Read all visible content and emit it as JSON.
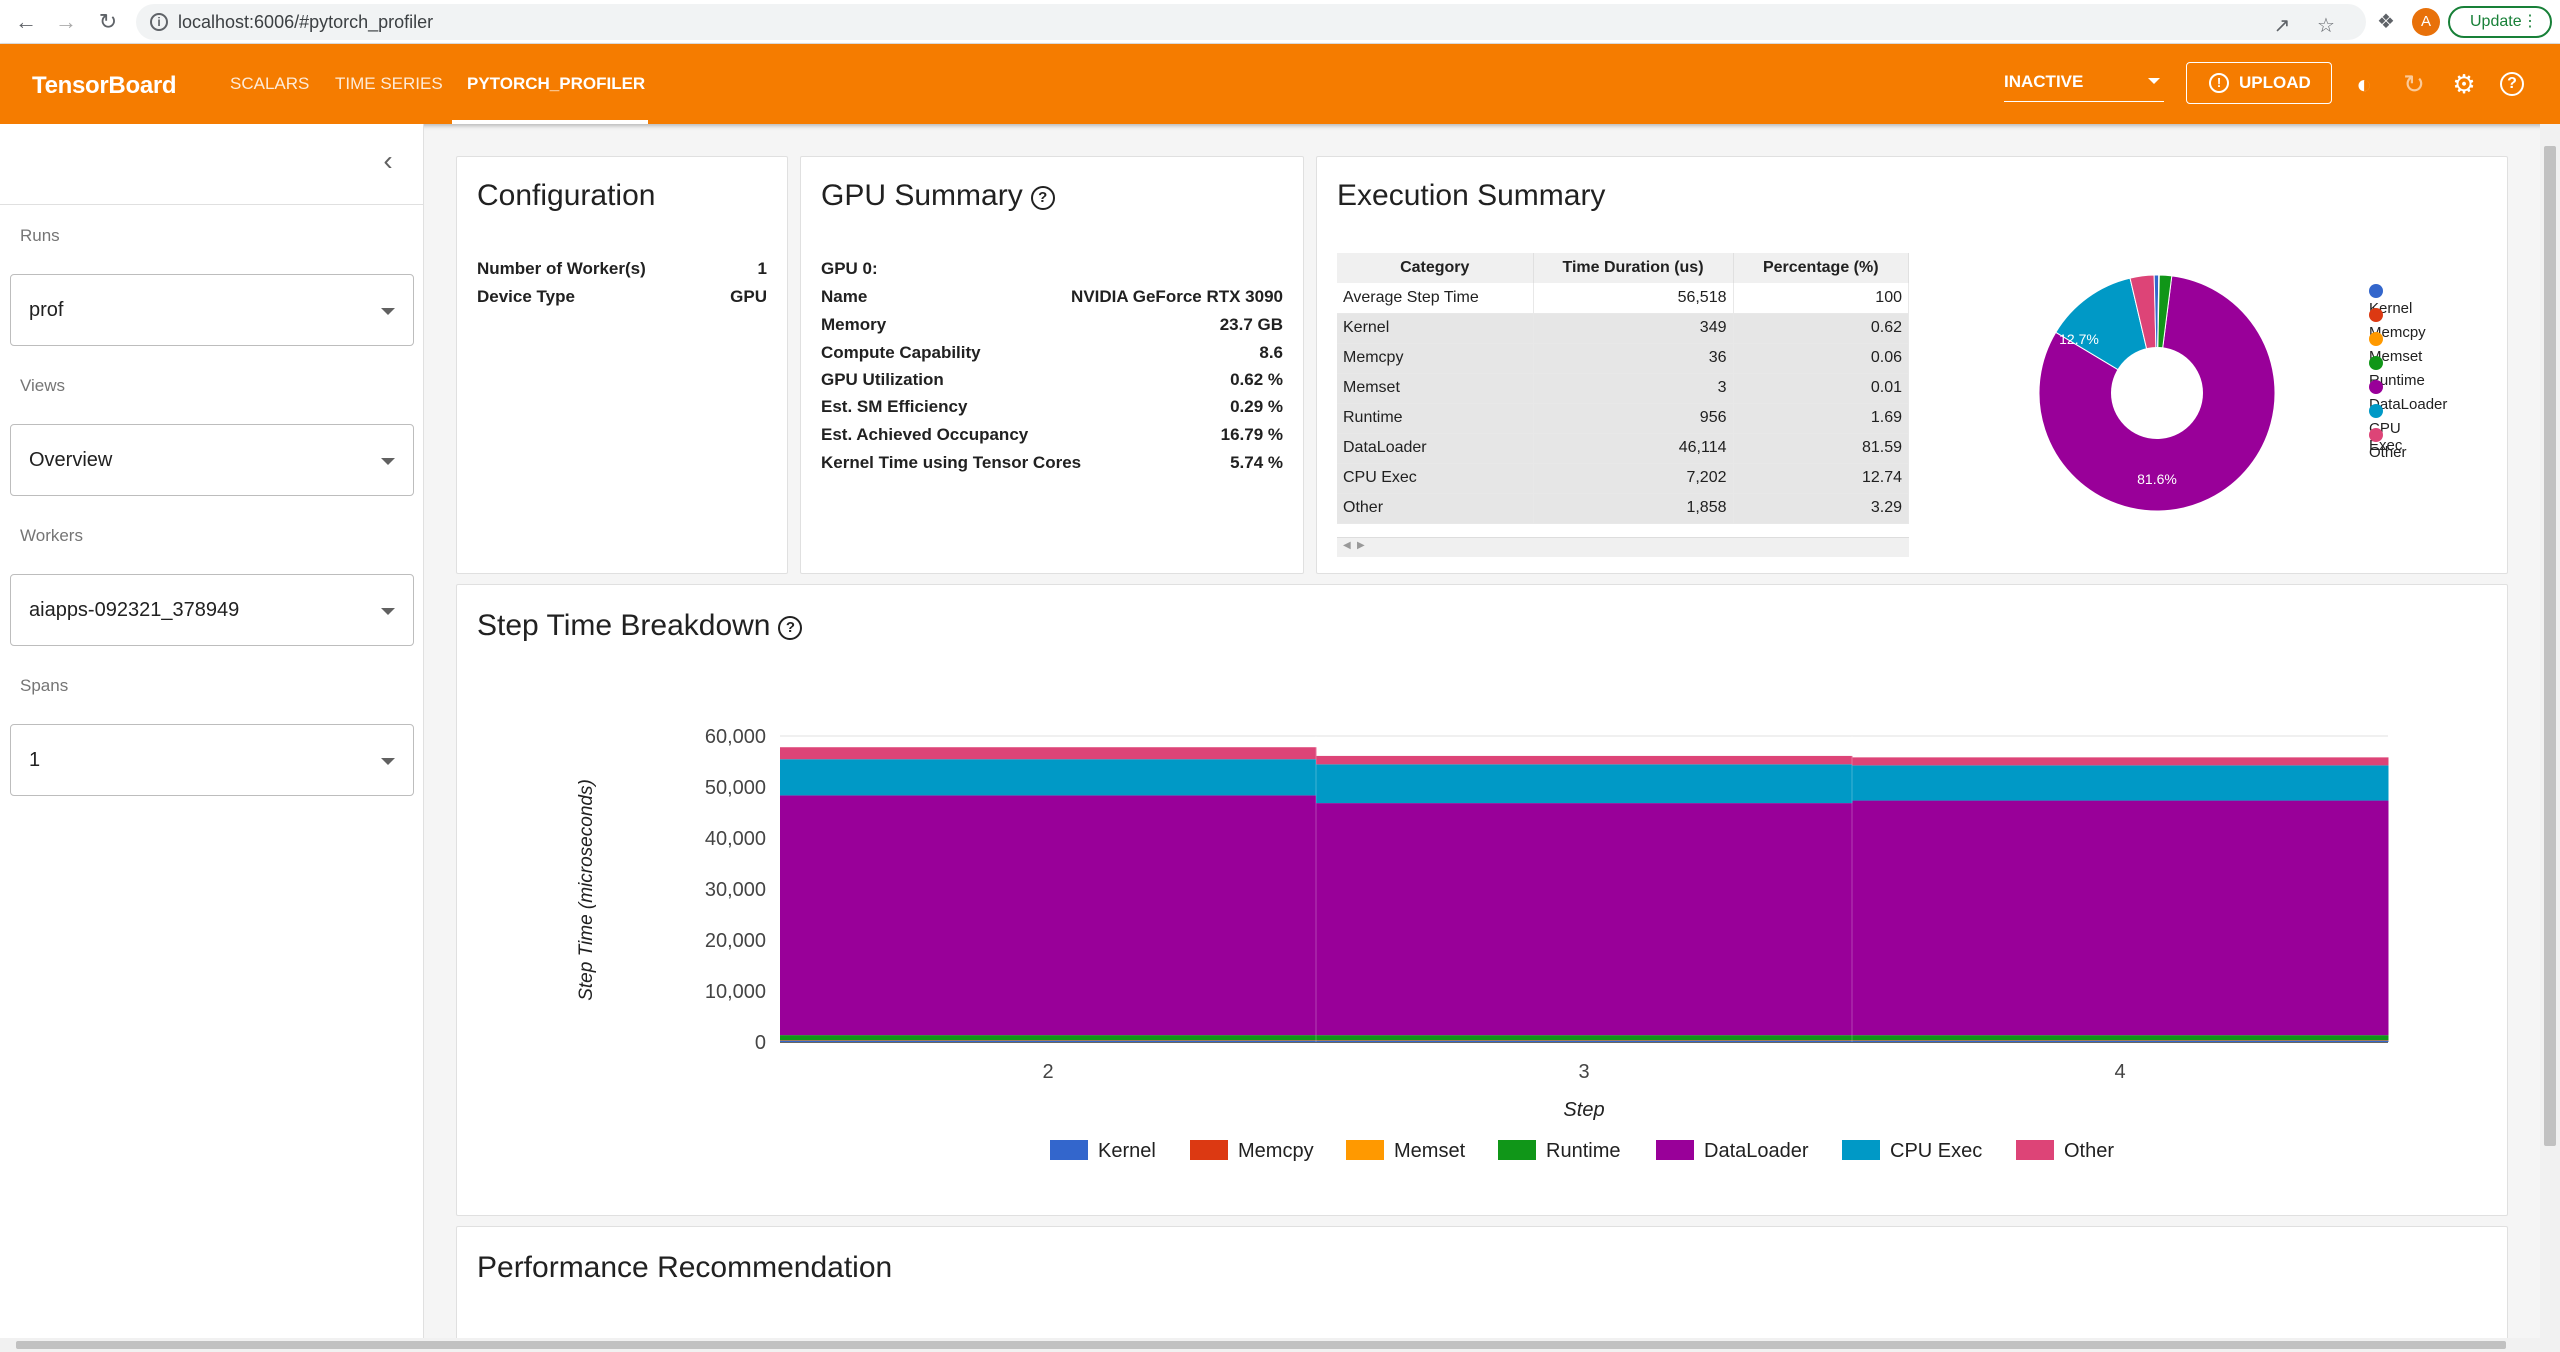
{
  "browser": {
    "url": "localhost:6006/#pytorch_profiler",
    "avatar_letter": "A",
    "update_label": "Update"
  },
  "header": {
    "brand": "TensorBoard",
    "tabs": [
      {
        "label": "SCALARS"
      },
      {
        "label": "TIME SERIES"
      },
      {
        "label": "PYTORCH_PROFILER"
      }
    ],
    "active_tab": "PYTORCH_PROFILER",
    "status_select": "INACTIVE",
    "upload_label": "UPLOAD"
  },
  "sidebar": {
    "runs": {
      "label": "Runs",
      "value": "prof"
    },
    "views": {
      "label": "Views",
      "value": "Overview"
    },
    "workers": {
      "label": "Workers",
      "value": "aiapps-092321_378949"
    },
    "spans": {
      "label": "Spans",
      "value": "1"
    }
  },
  "configuration": {
    "title": "Configuration",
    "rows": [
      {
        "key": "Number of Worker(s)",
        "value": "1"
      },
      {
        "key": "Device Type",
        "value": "GPU"
      }
    ]
  },
  "gpu_summary": {
    "title": "GPU Summary",
    "header": "GPU 0:",
    "rows": [
      {
        "key": "Name",
        "value": "NVIDIA GeForce RTX 3090"
      },
      {
        "key": "Memory",
        "value": "23.7 GB"
      },
      {
        "key": "Compute Capability",
        "value": "8.6"
      },
      {
        "key": "GPU Utilization",
        "value": "0.62 %"
      },
      {
        "key": "Est. SM Efficiency",
        "value": "0.29 %"
      },
      {
        "key": "Est. Achieved Occupancy",
        "value": "16.79 %"
      },
      {
        "key": "Kernel Time using Tensor Cores",
        "value": "5.74 %"
      }
    ]
  },
  "execution_summary": {
    "title": "Execution Summary",
    "columns": [
      "Category",
      "Time Duration (us)",
      "Percentage (%)"
    ],
    "rows": [
      [
        "Average Step Time",
        "56,518",
        "100"
      ],
      [
        "Kernel",
        "349",
        "0.62"
      ],
      [
        "Memcpy",
        "36",
        "0.06"
      ],
      [
        "Memset",
        "3",
        "0.01"
      ],
      [
        "Runtime",
        "956",
        "1.69"
      ],
      [
        "DataLoader",
        "46,114",
        "81.59"
      ],
      [
        "CPU Exec",
        "7,202",
        "12.74"
      ],
      [
        "Other",
        "1,858",
        "3.29"
      ]
    ],
    "pie_labels": {
      "dataloader": "81.6%",
      "cpu_exec": "12.7%"
    }
  },
  "colors": {
    "Kernel": "#3366cc",
    "Memcpy": "#dc3912",
    "Memset": "#ff9900",
    "Runtime": "#109618",
    "DataLoader": "#990099",
    "CPU Exec": "#0099c6",
    "Other": "#dd4477",
    "accent": "#f57c00"
  },
  "step_time": {
    "title": "Step Time Breakdown",
    "performance_title": "Performance Recommendation"
  },
  "chart_data": [
    {
      "type": "pie",
      "categories": [
        "Kernel",
        "Memcpy",
        "Memset",
        "Runtime",
        "DataLoader",
        "CPU Exec",
        "Other"
      ],
      "values": [
        0.62,
        0.06,
        0.01,
        1.69,
        81.59,
        12.74,
        3.29
      ],
      "legend_position": "right"
    },
    {
      "type": "area",
      "stacked": true,
      "title": "",
      "xlabel": "Step",
      "ylabel": "Step Time (microseconds)",
      "categories": [
        "2",
        "3",
        "4"
      ],
      "yticks": [
        "0",
        "10,000",
        "20,000",
        "30,000",
        "40,000",
        "50,000",
        "60,000"
      ],
      "ylim": [
        0,
        60000
      ],
      "series": [
        {
          "name": "Kernel",
          "values": [
            350,
            349,
            348
          ]
        },
        {
          "name": "Memcpy",
          "values": [
            36,
            36,
            36
          ]
        },
        {
          "name": "Memset",
          "values": [
            3,
            3,
            3
          ]
        },
        {
          "name": "Runtime",
          "values": [
            960,
            955,
            953
          ]
        },
        {
          "name": "DataLoader",
          "values": [
            47000,
            45500,
            46000
          ]
        },
        {
          "name": "CPU Exec",
          "values": [
            7100,
            7600,
            6900
          ]
        },
        {
          "name": "Other",
          "values": [
            2350,
            1650,
            1570
          ]
        }
      ],
      "legend_position": "bottom"
    }
  ]
}
